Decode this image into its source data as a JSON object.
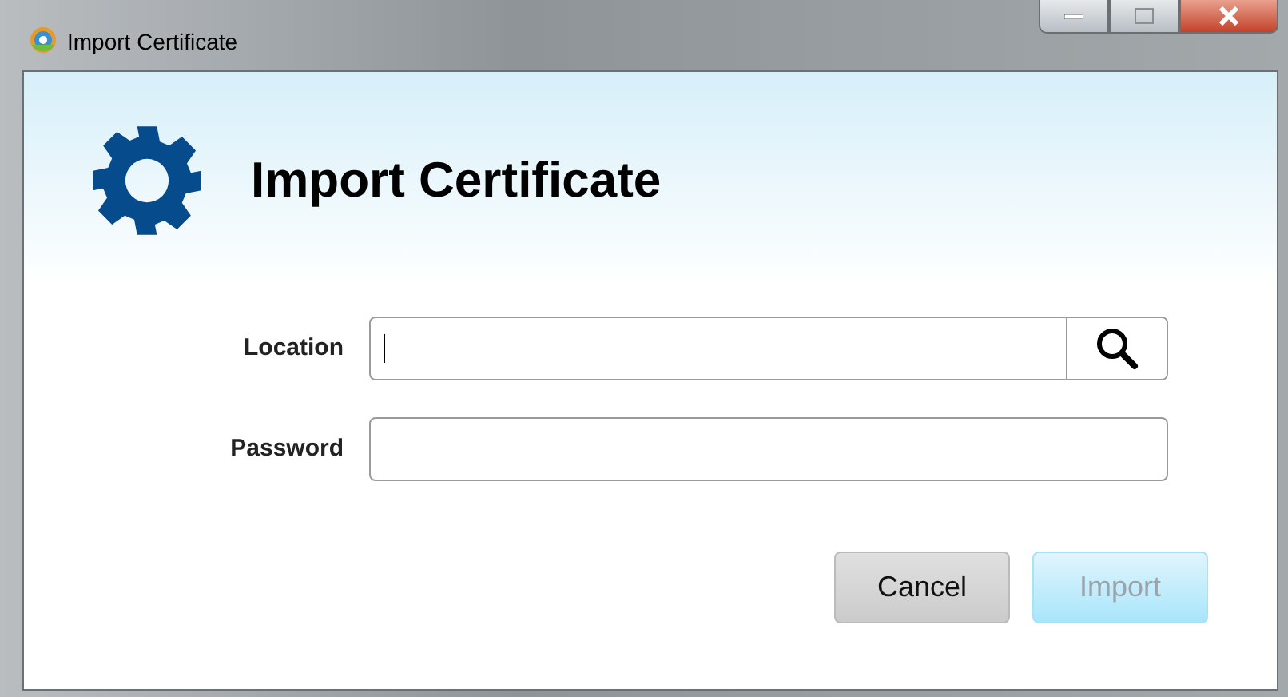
{
  "window": {
    "title": "Import Certificate"
  },
  "heading": "Import Certificate",
  "fields": [
    {
      "label": "Location",
      "kind": "browse"
    },
    {
      "label": "Password",
      "kind": "password"
    }
  ],
  "buttons": [
    {
      "label": "Cancel",
      "disabled": false
    },
    {
      "label": "Import",
      "disabled": true
    }
  ]
}
